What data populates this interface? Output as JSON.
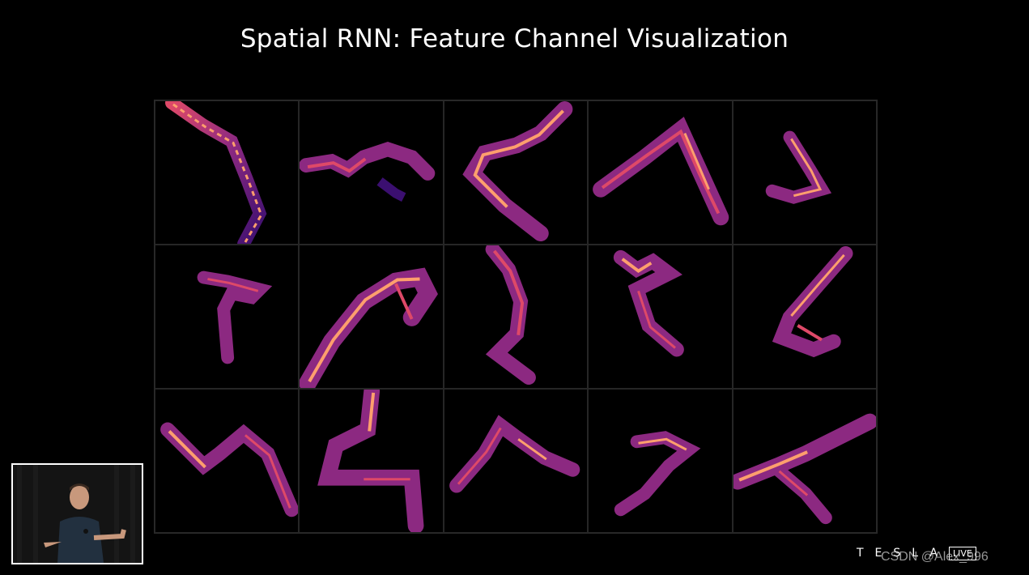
{
  "slide": {
    "title": "Spatial RNN: Feature Channel Visualization",
    "grid_rows": 3,
    "grid_cols": 5,
    "colormap": [
      "#000004",
      "#3b0f70",
      "#8c2981",
      "#de4968",
      "#fe9f6d",
      "#fcfdbf"
    ]
  },
  "branding": {
    "logo_letters": "TESLA",
    "live_badge": "LIVE",
    "watermark": "CSDN @Alex_996"
  },
  "speaker": {
    "description_icon": "presenter-video-icon"
  }
}
